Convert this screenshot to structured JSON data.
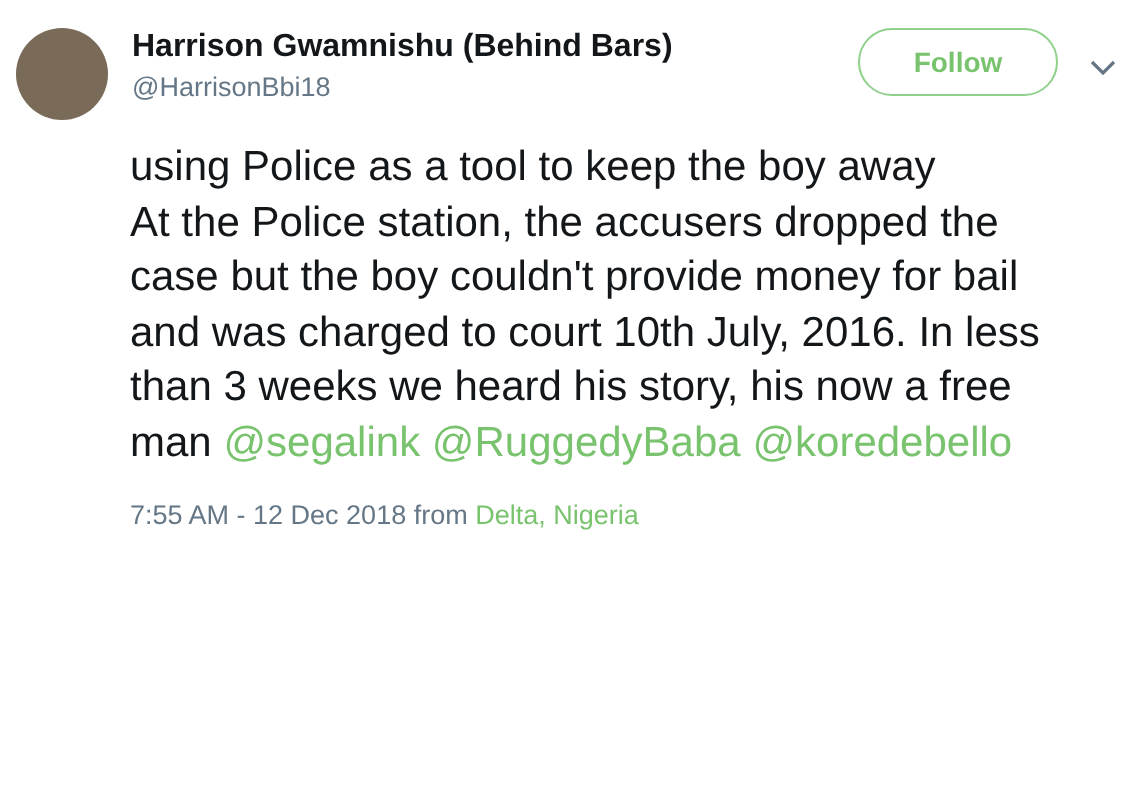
{
  "author": {
    "name": "Harrison Gwamnishu (Behind Bars)",
    "handle": "@HarrisonBbi18"
  },
  "follow_button": {
    "label": "Follow"
  },
  "tweet": {
    "paragraphs": [
      "using Police as a tool to keep the boy away",
      "At the Police station, the accusers dropped the case but the boy couldn't provide money for bail and was charged to court 10th July, 2016. In less than 3 weeks we heard his story, his now a free man"
    ],
    "mentions": [
      "@segalink",
      "@RuggedyBaba",
      "@koredebello"
    ]
  },
  "footer": {
    "time": "7:55 AM - 12 Dec 2018",
    "from": "from",
    "location": "Delta, Nigeria"
  }
}
